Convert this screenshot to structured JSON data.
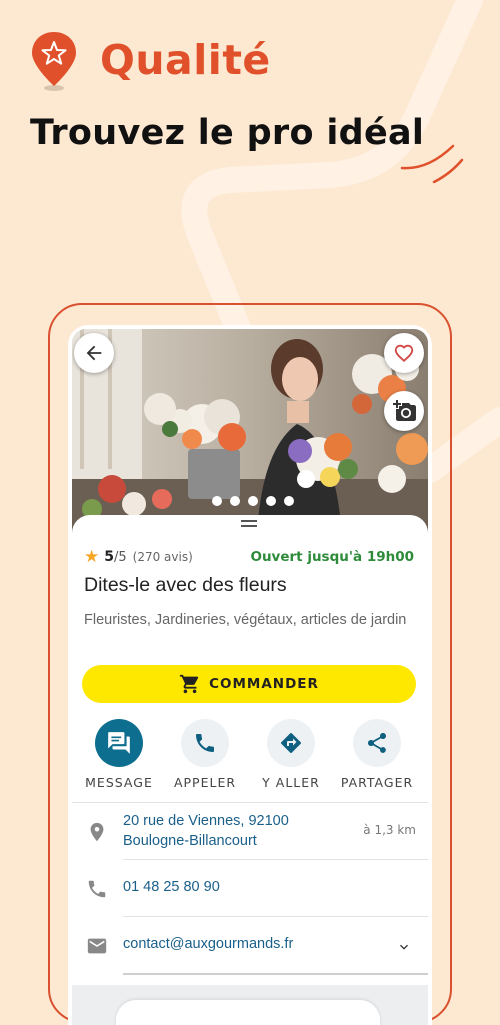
{
  "header": {
    "brand": "Qualité",
    "tagline": "Trouvez le pro idéal"
  },
  "colors": {
    "brand": "#e0512b",
    "background": "#fde8d2",
    "cta": "#ffe800",
    "link": "#1a5f8a",
    "open_status": "#2e8b3a",
    "primary_action": "#0e6e8f"
  },
  "listing": {
    "rating_value": "5",
    "rating_max": "/5",
    "rating_count": "(270 avis)",
    "rating_stars": 5,
    "status": "Ouvert jusqu'à 19h00",
    "name": "Dites-le avec des fleurs",
    "categories": "Fleuristes, Jardineries, végétaux, articles de jardin",
    "order_label": "COMMANDER",
    "photo_count": 5,
    "photo_active_index": 0
  },
  "actions": [
    {
      "label": "MESSAGE",
      "icon": "message-icon"
    },
    {
      "label": "APPELER",
      "icon": "phone-icon"
    },
    {
      "label": "Y ALLER",
      "icon": "directions-icon"
    },
    {
      "label": "PARTAGER",
      "icon": "share-icon"
    }
  ],
  "contact": {
    "address_line1": "20 rue de Viennes, 92100",
    "address_line2": "Boulogne-Billancourt",
    "distance": "à 1,3 km",
    "phone": "01 48 25 80 90",
    "email": "contact@auxgourmands.fr"
  }
}
